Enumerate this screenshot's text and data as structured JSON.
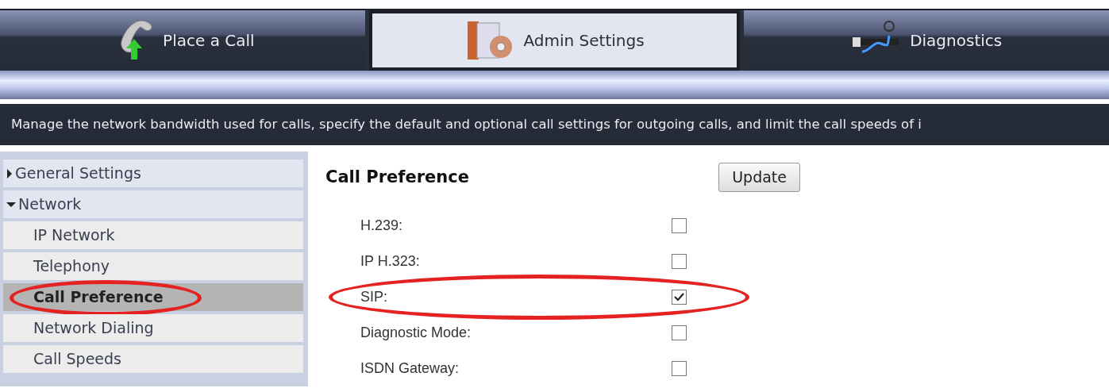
{
  "tabs": [
    {
      "label": "Place a Call",
      "kind": "phone",
      "selected": false
    },
    {
      "label": "Admin Settings",
      "kind": "admin",
      "selected": true
    },
    {
      "label": "Diagnostics",
      "kind": "diagnostics",
      "selected": false
    }
  ],
  "description": "Manage the network bandwidth used for calls, specify the default and optional call settings for outgoing calls, and limit the call speeds of i",
  "sidebar": {
    "items": [
      {
        "label": "General Settings",
        "expanded": false,
        "selected": false
      },
      {
        "label": "Network",
        "expanded": true,
        "selected": false,
        "children": [
          {
            "label": "IP Network",
            "selected": false,
            "highlighted": false
          },
          {
            "label": "Telephony",
            "selected": false,
            "highlighted": false
          },
          {
            "label": "Call Preference",
            "selected": true,
            "highlighted": true
          },
          {
            "label": "Network Dialing",
            "selected": false,
            "highlighted": false
          },
          {
            "label": "Call Speeds",
            "selected": false,
            "highlighted": false
          }
        ]
      }
    ]
  },
  "content": {
    "title": "Call Preference",
    "button": "Update",
    "settings": [
      {
        "label": "H.239:",
        "checked": false,
        "highlighted": false
      },
      {
        "label": "IP H.323:",
        "checked": false,
        "highlighted": false
      },
      {
        "label": "SIP:",
        "checked": true,
        "highlighted": true
      },
      {
        "label": "Diagnostic Mode:",
        "checked": false,
        "highlighted": false
      },
      {
        "label": "ISDN Gateway:",
        "checked": false,
        "highlighted": false
      }
    ]
  }
}
